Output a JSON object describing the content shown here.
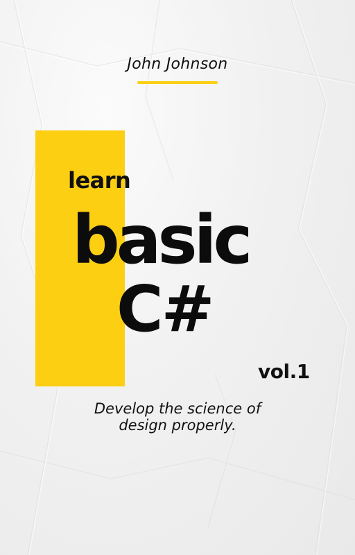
{
  "author": "John Johnson",
  "title": {
    "line1": "learn",
    "line2": "basic",
    "line3": "C#"
  },
  "volume": "vol.1",
  "tagline": {
    "line1": "Develop the science of",
    "line2": "design properly."
  },
  "colors": {
    "accent": "#fdcf13",
    "text": "#111111",
    "paper": "#f1f1f1"
  }
}
